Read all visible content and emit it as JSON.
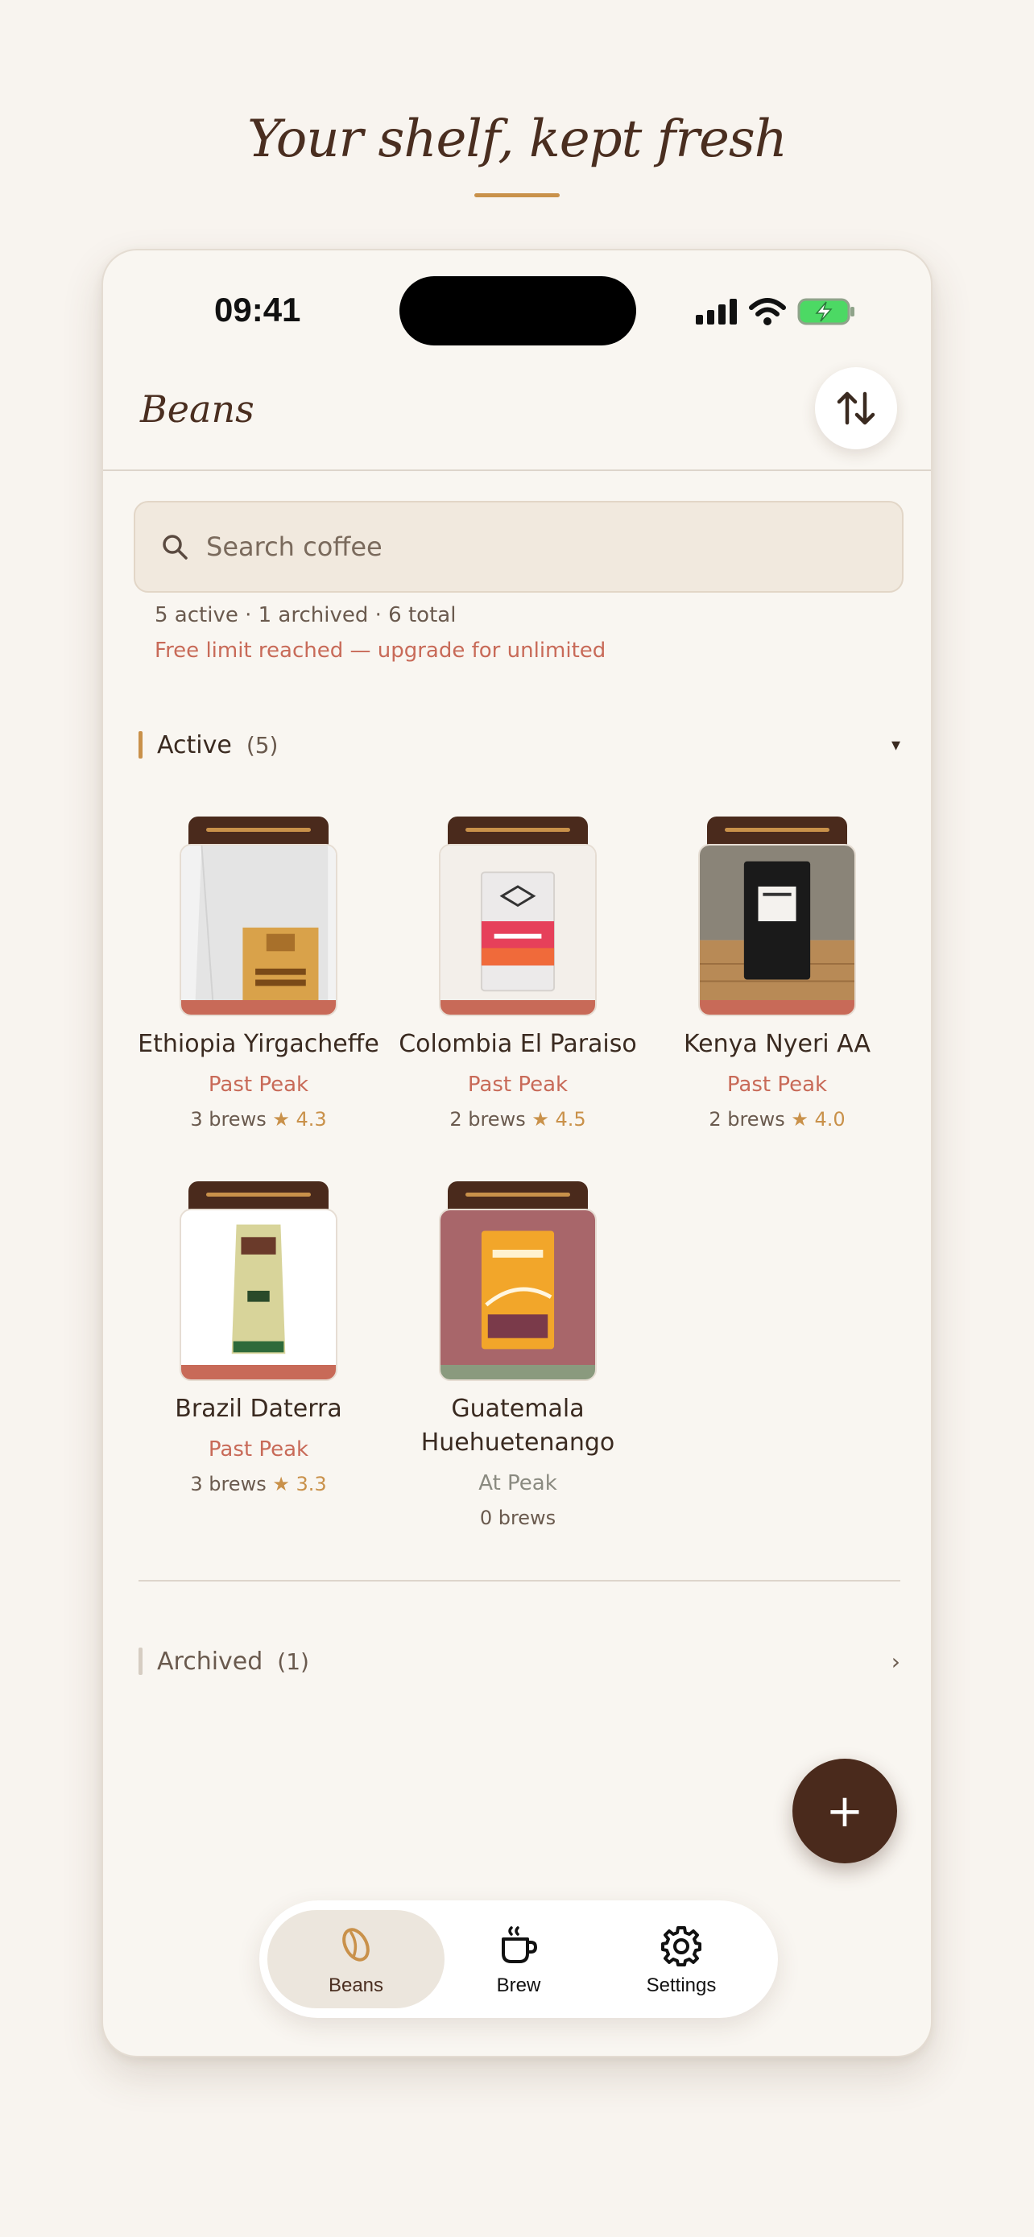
{
  "page": {
    "headline": "Your shelf, kept fresh"
  },
  "status_bar": {
    "time": "09:41"
  },
  "header": {
    "title": "Beans",
    "sort_icon": "sort-arrows-icon"
  },
  "search": {
    "placeholder": "Search coffee"
  },
  "summary": {
    "counts": "5 active · 1 archived · 6 total",
    "limit_notice": "Free limit reached — upgrade for unlimited"
  },
  "sections": {
    "active": {
      "label": "Active",
      "count": "(5)",
      "chevron": "▾"
    },
    "archived": {
      "label": "Archived",
      "count": "(1)",
      "chevron": "›"
    }
  },
  "beans": [
    {
      "name": "Ethiopia Yirgacheffe",
      "status": "Past Peak",
      "brews": "3 brews",
      "star": "★",
      "rating": "4.3"
    },
    {
      "name": "Colombia El Paraiso",
      "status": "Past Peak",
      "brews": "2 brews",
      "star": "★",
      "rating": "4.5"
    },
    {
      "name": "Kenya Nyeri AA",
      "status": "Past Peak",
      "brews": "2 brews",
      "star": "★",
      "rating": "4.0"
    },
    {
      "name": "Brazil Daterra",
      "status": "Past Peak",
      "brews": "3 brews",
      "star": "★",
      "rating": "3.3"
    },
    {
      "name": "Guatemala Huehuetenango",
      "status": "At Peak",
      "brews": "0 brews",
      "star": "",
      "rating": ""
    }
  ],
  "fab": {
    "label": "+"
  },
  "tabs": [
    {
      "label": "Beans",
      "icon": "coffee-bean-icon",
      "active": true
    },
    {
      "label": "Brew",
      "icon": "coffee-cup-icon",
      "active": false
    },
    {
      "label": "Settings",
      "icon": "gear-icon",
      "active": false
    }
  ],
  "colors": {
    "accent": "#c9914a",
    "dark_brown": "#4a2a1c",
    "past_peak": "#c86a58",
    "at_peak": "#8a9a7e",
    "background": "#f8f4ef"
  }
}
